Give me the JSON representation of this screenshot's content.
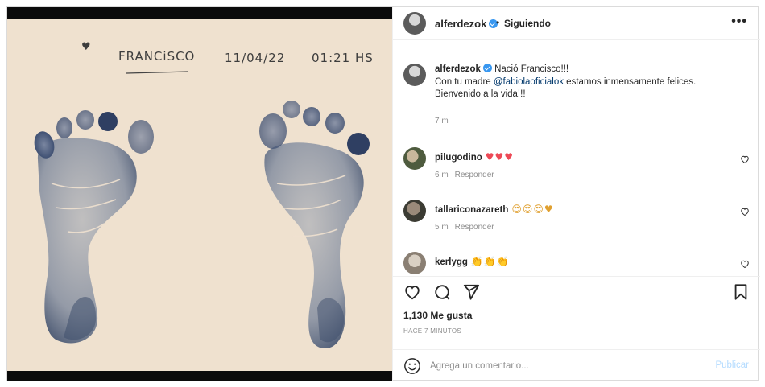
{
  "photo": {
    "handwriting": {
      "name": "FRANCiSCO",
      "date": "11/04/22",
      "time": "01:21 HS",
      "heart": "♥"
    }
  },
  "header": {
    "username": "alferdezok",
    "separator": "•",
    "follow_status": "Siguiendo",
    "more": "•••"
  },
  "caption": {
    "username": "alferdezok",
    "text_line1": "Nació Francisco!!!",
    "text_line2_pre": "Con tu madre ",
    "mention": "@fabiolaoficialok",
    "text_line2_post": " estamos inmensamente felices.",
    "text_line3": "Bienvenido a la vida!!!",
    "time": "7 m"
  },
  "comments": [
    {
      "username": "pilugodino",
      "text": "♥♥♥",
      "time": "6 m",
      "reply": "Responder"
    },
    {
      "username": "tallariconazareth",
      "text": "😍😍😍♥",
      "time": "5 m",
      "reply": "Responder"
    },
    {
      "username": "kerlygg",
      "text": "👏👏👏",
      "time": "",
      "reply": ""
    }
  ],
  "likes": "1,130 Me gusta",
  "time_ago": "HACE 7 MINUTOS",
  "add_comment": {
    "placeholder": "Agrega un comentario...",
    "publish": "Publicar"
  },
  "colors": {
    "link": "#00376b",
    "verified": "#3897f0",
    "heart_red": "#ed4956",
    "muted": "#8e8e8e",
    "publish_disabled": "#b3dbff",
    "paper": "#efe1cf",
    "ink": "#5c6a80"
  },
  "icons": [
    "verified-badge-icon",
    "more-options-icon",
    "heart-icon",
    "comment-icon",
    "share-icon",
    "bookmark-icon",
    "emoji-icon"
  ]
}
